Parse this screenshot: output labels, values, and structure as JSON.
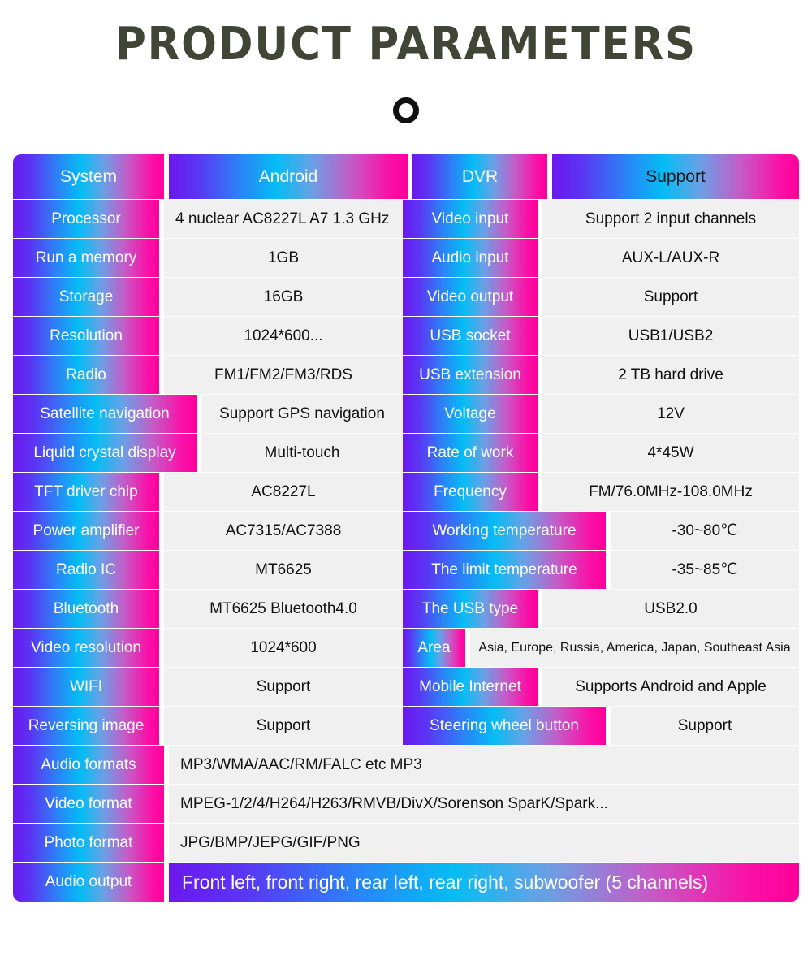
{
  "header": {
    "title": "PRODUCT PARAMETERS",
    "divider_icon": "ring-icon"
  },
  "colors": {
    "title_text": "#404536",
    "gradient_start": "#6b17f0",
    "gradient_mid": "#04bdf4",
    "gradient_end": "#ff0099",
    "value_bg": "#f0f0f0",
    "value_text": "#111111",
    "label_text": "#ffffff"
  },
  "table": {
    "header": {
      "left_label": "System",
      "left_value": "Android",
      "right_label": "DVR",
      "right_value": "Support"
    },
    "rows": [
      {
        "left_label": "Processor",
        "left_value": "4 nuclear   AC8227L A7 1.3 GHz",
        "left_value_align": "left",
        "right_label": "Video input",
        "right_value": "Support 2 input channels"
      },
      {
        "left_label": "Run a memory",
        "left_value": "1GB",
        "right_label": "Audio input",
        "right_value": "AUX-L/AUX-R"
      },
      {
        "left_label": "Storage",
        "left_value": "16GB",
        "right_label": "Video output",
        "right_value": "Support"
      },
      {
        "left_label": "Resolution",
        "left_value": "1024*600...",
        "right_label": "USB socket",
        "right_value": "USB1/USB2"
      },
      {
        "left_label": "Radio",
        "left_value": "FM1/FM2/FM3/RDS",
        "right_label": "USB extension",
        "right_value": "2 TB hard drive"
      },
      {
        "left_label": "Satellite navigation",
        "left_value": "Support GPS navigation",
        "left_label_wide": true,
        "right_label": "Voltage",
        "right_value": "12V"
      },
      {
        "left_label": "Liquid crystal display",
        "left_value": "Multi-touch",
        "left_label_wide": true,
        "right_label": "Rate of work",
        "right_value": "4*45W"
      },
      {
        "left_label": "TFT driver chip",
        "left_value": "AC8227L",
        "right_label": "Frequency",
        "right_value": "FM/76.0MHz-108.0MHz"
      },
      {
        "left_label": "Power amplifier",
        "left_value": "AC7315/AC7388",
        "right_label": "Working temperature",
        "right_value": "-30~80℃",
        "right_label_wide": true
      },
      {
        "left_label": "Radio IC",
        "left_value": "MT6625",
        "right_label": "The limit temperature",
        "right_value": "-35~85℃",
        "right_label_wide": true
      },
      {
        "left_label": "Bluetooth",
        "left_value": "MT6625 Bluetooth4.0",
        "right_label": "The USB type",
        "right_value": "USB2.0"
      },
      {
        "left_label": "Video resolution",
        "left_value": "1024*600",
        "right_label": "Area",
        "right_value": "Asia, Europe, Russia, America, Japan, Southeast Asia",
        "right_label_narrow": true,
        "right_value_small": true
      },
      {
        "left_label": "WIFI",
        "left_value": "Support",
        "right_label": "Mobile Internet",
        "right_value": "Supports Android and Apple"
      },
      {
        "left_label": "Reversing image",
        "left_value": "Support",
        "right_label": "Steering wheel button",
        "right_value": "Support",
        "right_label_wide": true
      }
    ],
    "full_rows": [
      {
        "label": "Audio formats",
        "value": "MP3/WMA/AAC/RM/FALC etc MP3"
      },
      {
        "label": "Video format",
        "value": "MPEG-1/2/4/H264/H263/RMVB/DivX/Sorenson SparK/Spark..."
      },
      {
        "label": "Photo format",
        "value": "JPG/BMP/JEPG/GIF/PNG"
      }
    ],
    "last_row": {
      "label": "Audio output",
      "value": "Front left, front right, rear left, rear right, subwoofer (5 channels)"
    }
  }
}
